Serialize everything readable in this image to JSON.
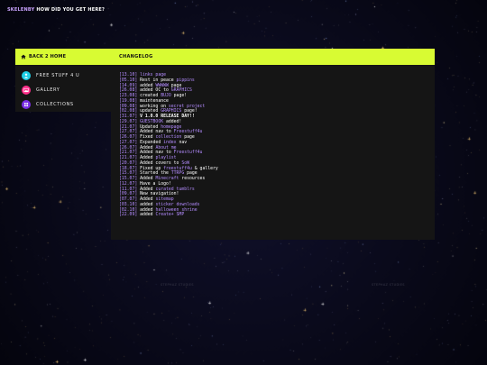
{
  "site": {
    "name": "SKELENBY",
    "tagline": "HOW DID YOU GET HERE?"
  },
  "sidebar": {
    "home": "BACK 2 HOME",
    "items": [
      {
        "label": "FREE STUFF 4 U",
        "icon": "person-icon",
        "color": "#1fd0e6"
      },
      {
        "label": "GALLERY",
        "icon": "image-icon",
        "color": "#ff2e8a"
      },
      {
        "label": "COLLECTIONS",
        "icon": "grid-icon",
        "color": "#7a2ee6"
      }
    ]
  },
  "changelog": {
    "title": "CHANGELOG",
    "entries": [
      {
        "date": "[13.10]",
        "parts": [
          [
            "links page",
            "link"
          ]
        ]
      },
      {
        "date": "[05.10]",
        "parts": [
          [
            "Rest in peace ",
            ""
          ],
          [
            "pippins",
            "link"
          ]
        ]
      },
      {
        "date": "[14.09]",
        "parts": [
          [
            "added ",
            ""
          ],
          [
            "WWWWW",
            "link"
          ],
          [
            " page",
            ""
          ]
        ]
      },
      {
        "date": "[26.08]",
        "parts": [
          [
            "added OC to ",
            ""
          ],
          [
            "GRAPHICS",
            "link"
          ]
        ]
      },
      {
        "date": "[23.08]",
        "parts": [
          [
            "created ",
            ""
          ],
          [
            "BUJO",
            "link"
          ],
          [
            " page!",
            ""
          ]
        ]
      },
      {
        "date": "[19.08]",
        "parts": [
          [
            "maintenance",
            ""
          ]
        ]
      },
      {
        "date": "[09.08]",
        "parts": [
          [
            "working on ",
            ""
          ],
          [
            "secret project",
            "link"
          ]
        ]
      },
      {
        "date": "[02.08]",
        "parts": [
          [
            "updated ",
            ""
          ],
          [
            "GRAPHICS",
            "link"
          ],
          [
            " page!",
            ""
          ]
        ]
      },
      {
        "date": "[31.07]",
        "parts": [
          [
            "V 1.0.0 RELEASE DAY!!",
            "bold"
          ]
        ]
      },
      {
        "date": "[29.07]",
        "parts": [
          [
            "GUESTBOOK",
            "link"
          ],
          [
            " added!",
            ""
          ]
        ]
      },
      {
        "date": "[21.07]",
        "parts": [
          [
            "Updated ",
            ""
          ],
          [
            "homepage",
            "link"
          ]
        ]
      },
      {
        "date": "[27.07]",
        "parts": [
          [
            "Added nav to ",
            ""
          ],
          [
            "Freestuff4u",
            "link"
          ]
        ]
      },
      {
        "date": "[26.07]",
        "parts": [
          [
            "Fixed ",
            ""
          ],
          [
            "collection",
            "link"
          ],
          [
            " page",
            ""
          ]
        ]
      },
      {
        "date": "[27.07]",
        "parts": [
          [
            "Expanded ",
            ""
          ],
          [
            "index",
            "link"
          ],
          [
            " nav",
            ""
          ]
        ]
      },
      {
        "date": "[26.07]",
        "parts": [
          [
            "Added ",
            ""
          ],
          [
            "About me",
            "link"
          ]
        ]
      },
      {
        "date": "[21.07]",
        "parts": [
          [
            "Added nav to ",
            ""
          ],
          [
            "Freestuff4u",
            "link"
          ]
        ]
      },
      {
        "date": "[21.07]",
        "parts": [
          [
            "Added ",
            ""
          ],
          [
            "playlist",
            "link"
          ]
        ]
      },
      {
        "date": "[20.07]",
        "parts": [
          [
            "Added covers to ",
            ""
          ],
          [
            "SoW",
            "link"
          ]
        ]
      },
      {
        "date": "[18.07]",
        "parts": [
          [
            "Fixed up ",
            ""
          ],
          [
            "freestuff4u",
            "link"
          ],
          [
            " & gallery",
            ""
          ]
        ]
      },
      {
        "date": "[15.07]",
        "parts": [
          [
            "Started the ",
            ""
          ],
          [
            "TTRPG",
            "link"
          ],
          [
            " page",
            ""
          ]
        ]
      },
      {
        "date": "[15.07]",
        "parts": [
          [
            "Added ",
            ""
          ],
          [
            "Minecraft",
            "link"
          ],
          [
            " resources",
            ""
          ]
        ]
      },
      {
        "date": "[12.07]",
        "parts": [
          [
            "Have a Logo!",
            ""
          ]
        ]
      },
      {
        "date": "[11.07]",
        "parts": [
          [
            "Added ",
            ""
          ],
          [
            "curated tumblrs",
            "link"
          ]
        ]
      },
      {
        "date": "[09.07]",
        "parts": [
          [
            "New navigation!",
            ""
          ]
        ]
      },
      {
        "date": "[07.07]",
        "parts": [
          [
            "Added ",
            ""
          ],
          [
            "sitemap",
            "link"
          ]
        ]
      },
      {
        "date": "[03.10]",
        "parts": [
          [
            "added ",
            ""
          ],
          [
            "sticker downloads",
            "link"
          ]
        ]
      },
      {
        "date": "[02.10]",
        "parts": [
          [
            "added ",
            ""
          ],
          [
            "halloween shrine",
            "link"
          ]
        ]
      },
      {
        "date": "[22.09]",
        "parts": [
          [
            "added ",
            ""
          ],
          [
            "Create+ SMP",
            "link"
          ]
        ]
      }
    ]
  },
  "watermarks": [
    "STEPHAZ STUDIES",
    "STEPHAZ STUDIES"
  ],
  "colors": {
    "accent": "#d8fb33",
    "link": "#b48cff",
    "panel": "#151515",
    "background": "#050510"
  }
}
